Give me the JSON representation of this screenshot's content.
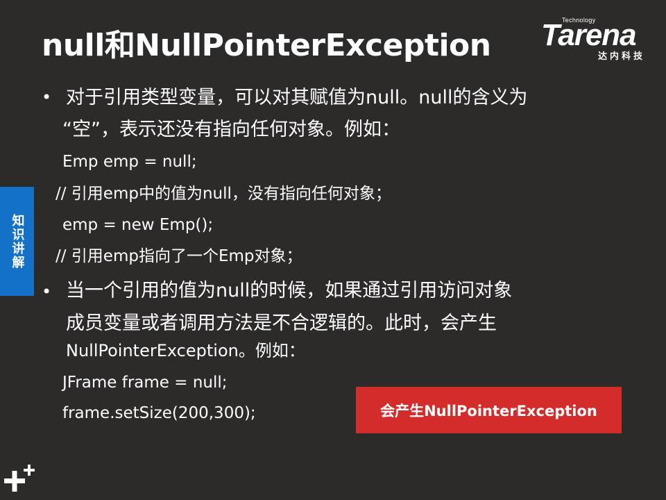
{
  "slide": {
    "title": "null和NullPointerException",
    "brand": {
      "technology": "Technology",
      "name": "Tarena",
      "cn": "达内科技"
    },
    "side_tab": "知识讲解",
    "bullet_symbol": "•",
    "section1": {
      "line1": "对于引用类型变量，可以对其赋值为null。null的含义为",
      "line2": "“空”，表示还没有指向任何对象。例如：",
      "code": [
        "Emp emp = null;",
        "// 引用emp中的值为null，没有指向任何对象；",
        "emp = new Emp();",
        "// 引用emp指向了一个Emp对象；"
      ]
    },
    "section2": {
      "line1": "当一个引用的值为null的时候，如果通过引用访问对象",
      "line2": "成员变量或者调用方法是不合逻辑的。此时，会产生",
      "line3": "NullPointerException。例如：",
      "code": [
        "JFrame frame = null;",
        "frame.setSize(200,300);"
      ]
    },
    "callout": "会产生NullPointerException"
  }
}
